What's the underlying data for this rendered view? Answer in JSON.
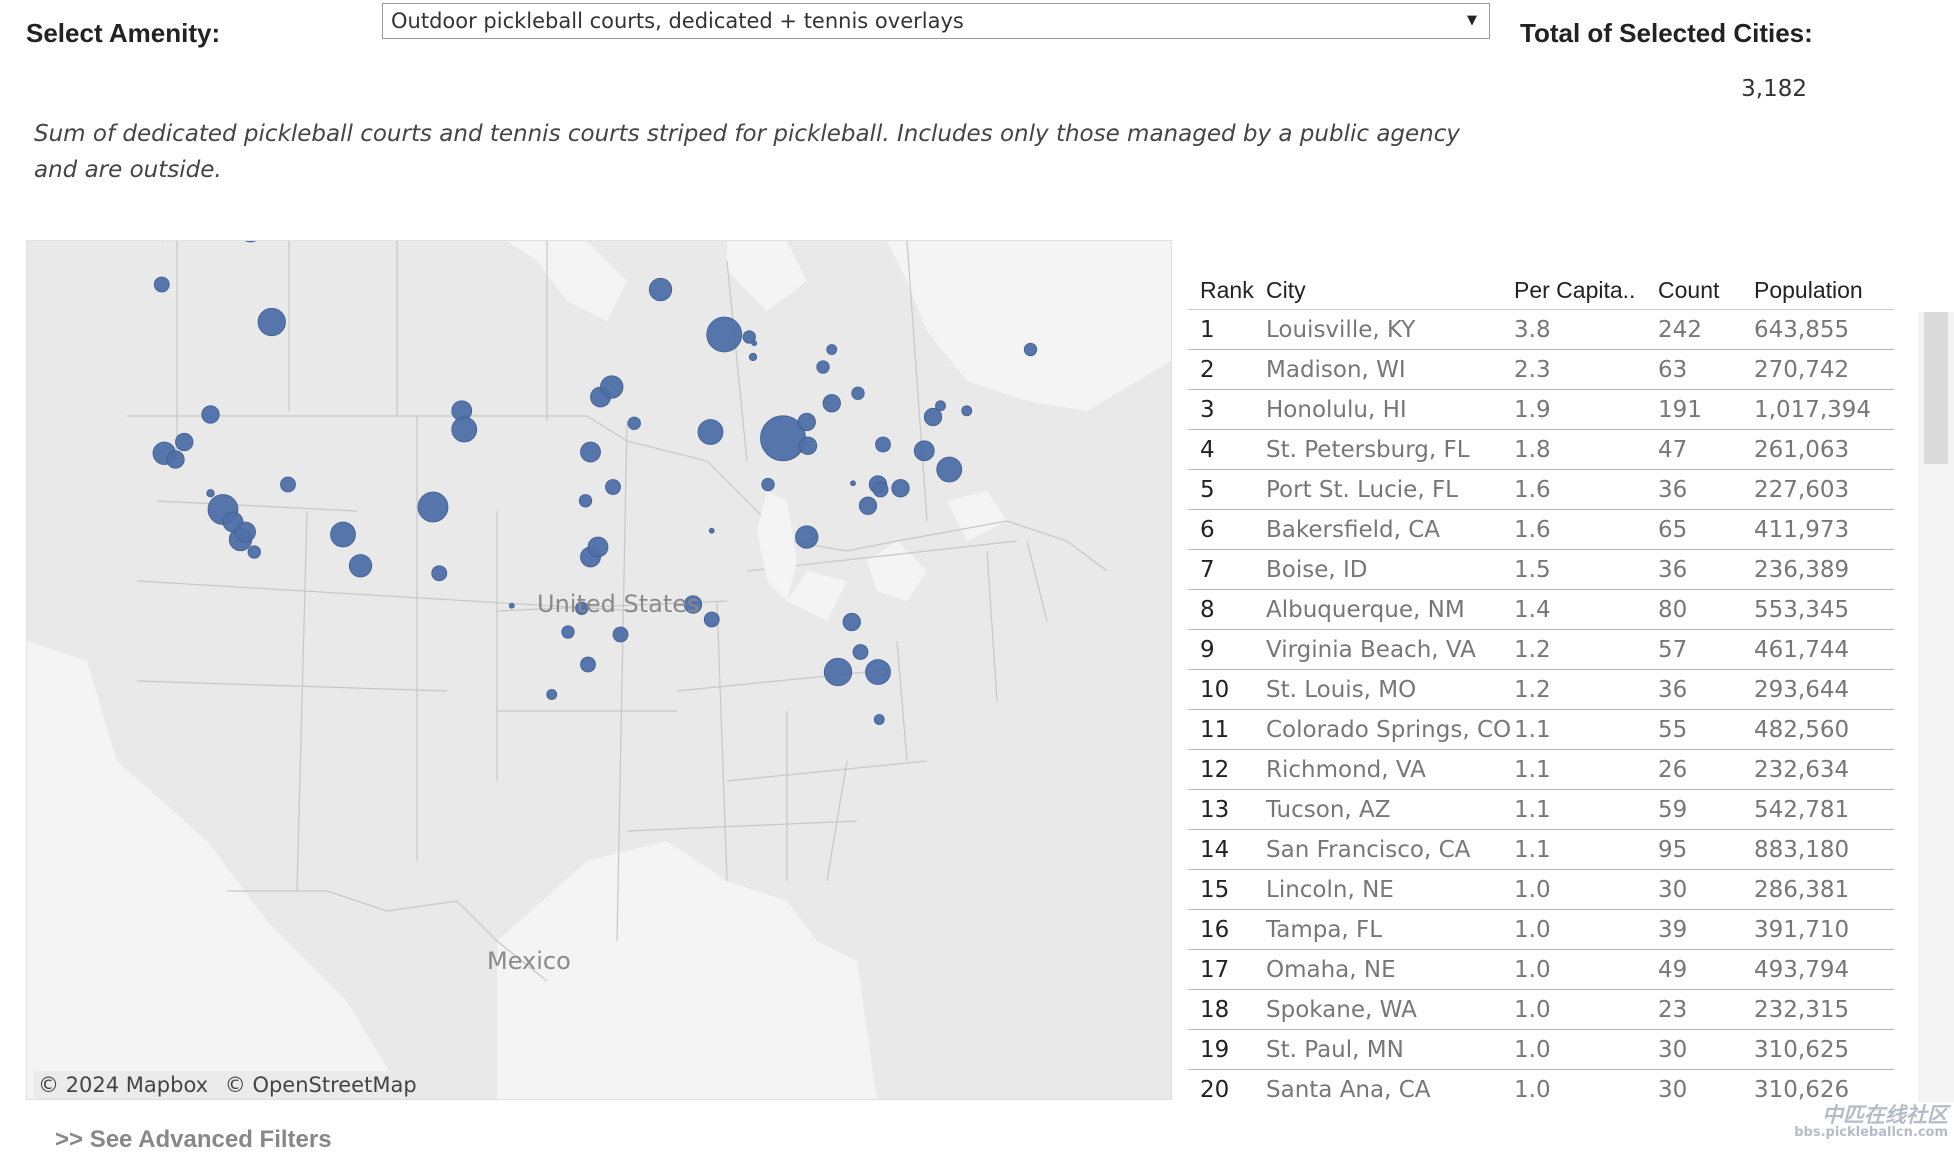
{
  "amenity_label": "Select Amenity:",
  "amenity_value": "Outdoor pickleball courts, dedicated + tennis overlays",
  "total_label": "Total of Selected Cities:",
  "total_value": "3,182",
  "description": "Sum of dedicated pickleball courts and tennis courts striped for pickleball. Includes only those managed by a public agency and are outside.",
  "map": {
    "labels": [
      "United States",
      "Mexico"
    ],
    "attribution": [
      "© 2024 Mapbox",
      "© OpenStreetMap"
    ],
    "bubble_color": "#4e6fa7"
  },
  "see_filters": ">> See Advanced Filters",
  "table": {
    "headers": [
      "Rank",
      "City",
      "Per Capita..",
      "Count",
      "Population"
    ],
    "rows": [
      [
        "1",
        "Louisville, KY",
        "3.8",
        "242",
        "643,855"
      ],
      [
        "2",
        "Madison, WI",
        "2.3",
        "63",
        "270,742"
      ],
      [
        "3",
        "Honolulu, HI",
        "1.9",
        "191",
        "1,017,394"
      ],
      [
        "4",
        "St. Petersburg, FL",
        "1.8",
        "47",
        "261,063"
      ],
      [
        "5",
        "Port St. Lucie, FL",
        "1.6",
        "36",
        "227,603"
      ],
      [
        "6",
        "Bakersfield, CA",
        "1.6",
        "65",
        "411,973"
      ],
      [
        "7",
        "Boise, ID",
        "1.5",
        "36",
        "236,389"
      ],
      [
        "8",
        "Albuquerque, NM",
        "1.4",
        "80",
        "553,345"
      ],
      [
        "9",
        "Virginia Beach, VA",
        "1.2",
        "57",
        "461,744"
      ],
      [
        "10",
        "St. Louis, MO",
        "1.2",
        "36",
        "293,644"
      ],
      [
        "11",
        "Colorado Springs, CO",
        "1.1",
        "55",
        "482,560"
      ],
      [
        "12",
        "Richmond, VA",
        "1.1",
        "26",
        "232,634"
      ],
      [
        "13",
        "Tucson, AZ",
        "1.1",
        "59",
        "542,781"
      ],
      [
        "14",
        "San Francisco, CA",
        "1.1",
        "95",
        "883,180"
      ],
      [
        "15",
        "Lincoln, NE",
        "1.0",
        "30",
        "286,381"
      ],
      [
        "16",
        "Tampa, FL",
        "1.0",
        "39",
        "391,710"
      ],
      [
        "17",
        "Omaha, NE",
        "1.0",
        "49",
        "493,794"
      ],
      [
        "18",
        "Spokane, WA",
        "1.0",
        "23",
        "232,315"
      ],
      [
        "19",
        "St. Paul, MN",
        "1.0",
        "30",
        "310,625"
      ],
      [
        "20",
        "Santa Ana, CA",
        "1.0",
        "30",
        "310,626"
      ]
    ]
  },
  "watermark": [
    "中匹在线社区",
    "bbs.pickleballcn.com"
  ]
}
